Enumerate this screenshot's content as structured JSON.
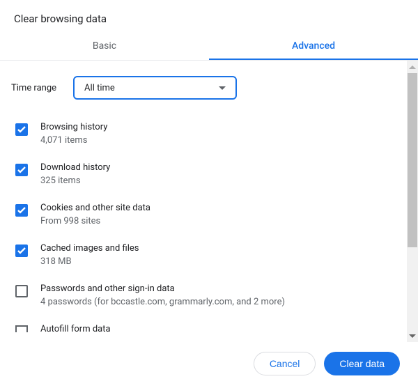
{
  "title": "Clear browsing data",
  "tabs": {
    "basic": "Basic",
    "advanced": "Advanced"
  },
  "time": {
    "label": "Time range",
    "value": "All time"
  },
  "items": [
    {
      "title": "Browsing history",
      "sub": "4,071 items",
      "checked": true
    },
    {
      "title": "Download history",
      "sub": "325 items",
      "checked": true
    },
    {
      "title": "Cookies and other site data",
      "sub": "From 998 sites",
      "checked": true
    },
    {
      "title": "Cached images and files",
      "sub": "318 MB",
      "checked": true
    },
    {
      "title": "Passwords and other sign-in data",
      "sub": "4 passwords (for bccastle.com, grammarly.com, and 2 more)",
      "checked": false
    }
  ],
  "partial_item": {
    "title": "Autofill form data"
  },
  "buttons": {
    "cancel": "Cancel",
    "clear": "Clear data"
  }
}
